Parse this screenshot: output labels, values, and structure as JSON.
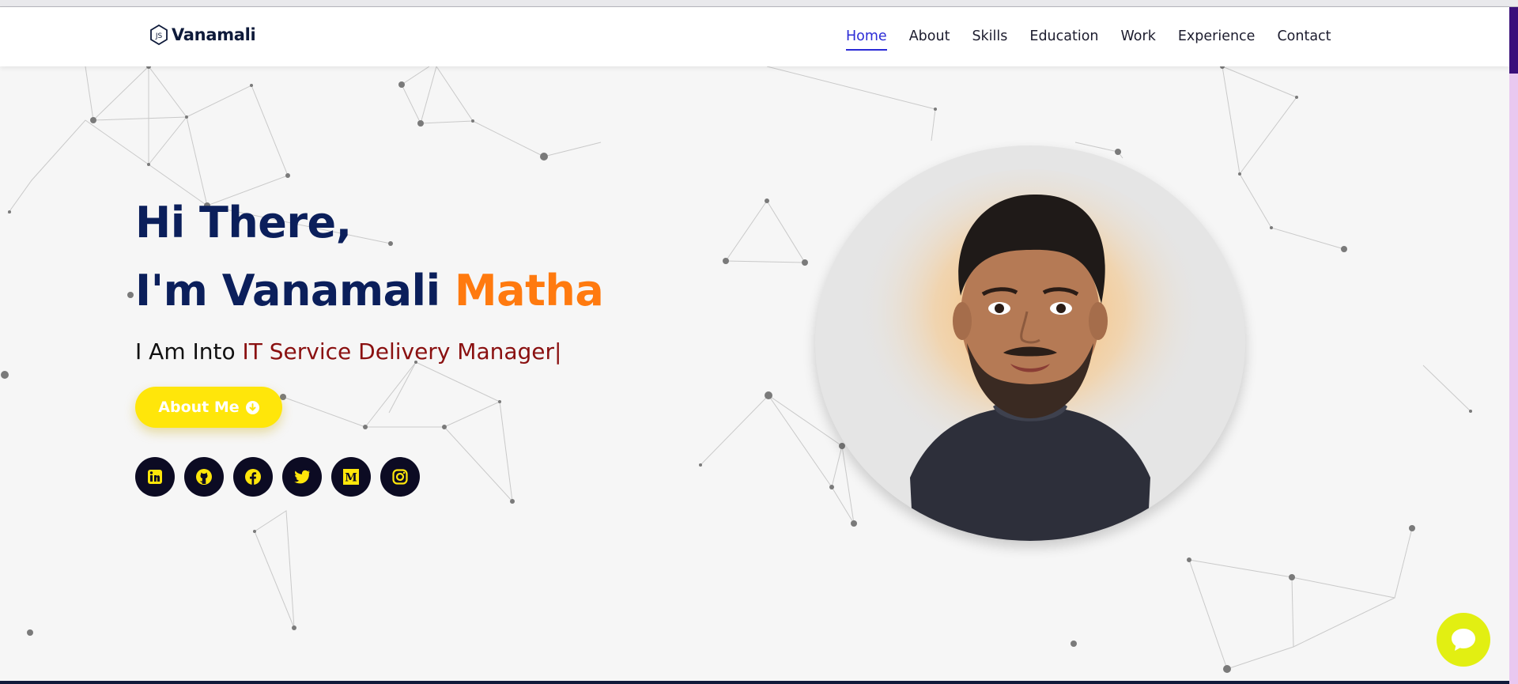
{
  "brand": {
    "name": "Vanamali",
    "logo_icon": "js-hexagon-icon"
  },
  "nav": {
    "items": [
      {
        "label": "Home",
        "active": true
      },
      {
        "label": "About",
        "active": false
      },
      {
        "label": "Skills",
        "active": false
      },
      {
        "label": "Education",
        "active": false
      },
      {
        "label": "Work",
        "active": false
      },
      {
        "label": "Experience",
        "active": false
      },
      {
        "label": "Contact",
        "active": false
      }
    ]
  },
  "hero": {
    "greeting": "Hi There,",
    "intro": "I'm Vanamali ",
    "highlight_name": "Matha",
    "typed_prefix": "I Am Into ",
    "typed_role": "IT Service Delivery Manager",
    "cursor": "|",
    "cta_label": "About Me",
    "cta_icon": "arrow-circle-down-icon"
  },
  "socials": [
    {
      "name": "linkedin-icon"
    },
    {
      "name": "github-icon"
    },
    {
      "name": "facebook-icon"
    },
    {
      "name": "twitter-icon"
    },
    {
      "name": "medium-icon"
    },
    {
      "name": "instagram-icon"
    }
  ],
  "chat": {
    "icon": "chat-bubble-icon"
  },
  "colors": {
    "navy": "#0b1f5b",
    "orange": "#ff7a0f",
    "role_red": "#8a1010",
    "yellow": "#ffe60a",
    "nav_active": "#2b2bd6",
    "chat_bg": "#e2ef12"
  }
}
